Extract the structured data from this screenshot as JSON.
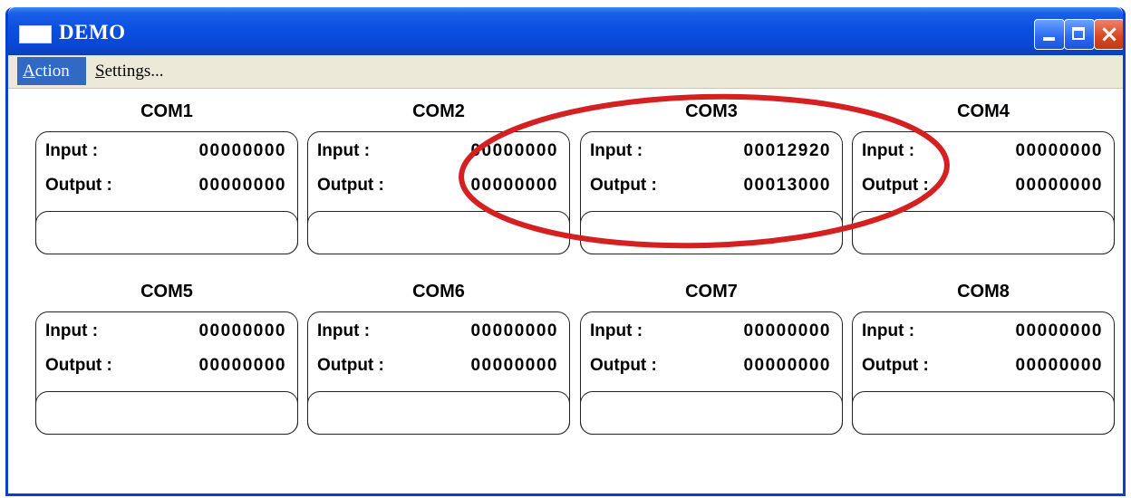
{
  "window": {
    "title": "DEMO"
  },
  "menu": {
    "action_underlined": "A",
    "action_rest": "ction",
    "settings_underlined": "S",
    "settings_rest": "ettings..."
  },
  "ports": [
    {
      "name": "COM1",
      "input_label": "Input  :",
      "input": "00000000",
      "output_label": "Output :",
      "output": "00000000"
    },
    {
      "name": "COM2",
      "input_label": "Input  :",
      "input": "00000000",
      "output_label": "Output :",
      "output": "00000000"
    },
    {
      "name": "COM3",
      "input_label": "Input  :",
      "input": "00012920",
      "output_label": "Output :",
      "output": "00013000"
    },
    {
      "name": "COM4",
      "input_label": "Input  :",
      "input": "00000000",
      "output_label": "Output :",
      "output": "00000000"
    },
    {
      "name": "COM5",
      "input_label": "Input  :",
      "input": "00000000",
      "output_label": "Output :",
      "output": "00000000"
    },
    {
      "name": "COM6",
      "input_label": "Input  :",
      "input": "00000000",
      "output_label": "Output :",
      "output": "00000000"
    },
    {
      "name": "COM7",
      "input_label": "Input  :",
      "input": "00000000",
      "output_label": "Output :",
      "output": "00000000"
    },
    {
      "name": "COM8",
      "input_label": "Input  :",
      "input": "00000000",
      "output_label": "Output :",
      "output": "00000000"
    }
  ],
  "colors": {
    "titlebar": "#0a47d6",
    "menu_active": "#316ac5",
    "highlight_annotation": "#d42020"
  }
}
